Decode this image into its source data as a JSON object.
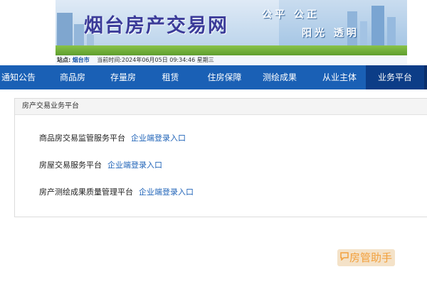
{
  "header": {
    "site_title": "烟台房产交易网",
    "slogan_line1": "公平  公正",
    "slogan_line2": "阳光  透明",
    "location_label": "站点:",
    "location_city": "烟台市",
    "datetime": "当前时间:2024年06月05日 09:34:46 星期三"
  },
  "nav": {
    "items": [
      {
        "label": "通知公告"
      },
      {
        "label": "商品房"
      },
      {
        "label": "存量房"
      },
      {
        "label": "租赁"
      },
      {
        "label": "住房保障"
      },
      {
        "label": "测绘成果"
      },
      {
        "label": "从业主体"
      },
      {
        "label": "业务平台"
      }
    ]
  },
  "panel": {
    "title": "房产交易业务平台",
    "rows": [
      {
        "name": "商品房交易监管服务平台",
        "link": "企业端登录入口"
      },
      {
        "name": "房屋交易服务平台",
        "link": "企业端登录入口"
      },
      {
        "name": "房产测绘成果质量管理平台",
        "link": "企业端登录入口"
      }
    ]
  },
  "watermark": {
    "icon": "chat-icon",
    "text": "房管助手"
  },
  "colors": {
    "nav_bg": "#1a60b5",
    "nav_active": "#0c3d87",
    "link": "#1f63b8",
    "title": "#3b3b99"
  }
}
